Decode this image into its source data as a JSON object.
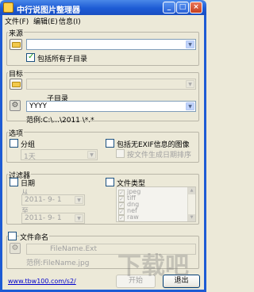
{
  "window": {
    "title": "中行说图片整理器"
  },
  "menu": {
    "file": "文件(F)",
    "edit": "编辑(E)",
    "info": "信息(I)"
  },
  "source": {
    "label": "来源",
    "path_value": "",
    "include_subdirs_label": "包括所有子目录",
    "include_subdirs_checked": true
  },
  "target": {
    "label": "目标",
    "path_value": "",
    "subdir_label": "子目录",
    "subdir_value": "YYYY",
    "example_label": "范例:C:\\...\\2011 \\*.*"
  },
  "options": {
    "label": "选项",
    "group_label": "分组",
    "group_checked": false,
    "group_value": "1天",
    "include_no_exif_label": "包括无EXIF信息的图像",
    "include_no_exif_checked": false,
    "sort_by_filetime_label": "按文件生成日期排序",
    "sort_by_filetime_checked": false
  },
  "filter": {
    "label": "过滤器",
    "date_label": "日期",
    "date_checked": false,
    "from_label": "从",
    "from_value": "2011- 9- 1",
    "to_label": "至",
    "to_value": "2011- 9- 1",
    "filetype_label": "文件类型",
    "filetype_checked": false,
    "filetypes": [
      "jpeg",
      "tiff",
      "dng",
      "nef",
      "raw"
    ]
  },
  "naming": {
    "label": "文件命名",
    "checked": false,
    "pattern_placeholder": "FileName.Ext",
    "example_label": "范例:FileName.jpg"
  },
  "footer": {
    "link": "www.tbw100.com/s2/",
    "start_button": "开始",
    "exit_button": "退出"
  },
  "watermark": "下载吧"
}
